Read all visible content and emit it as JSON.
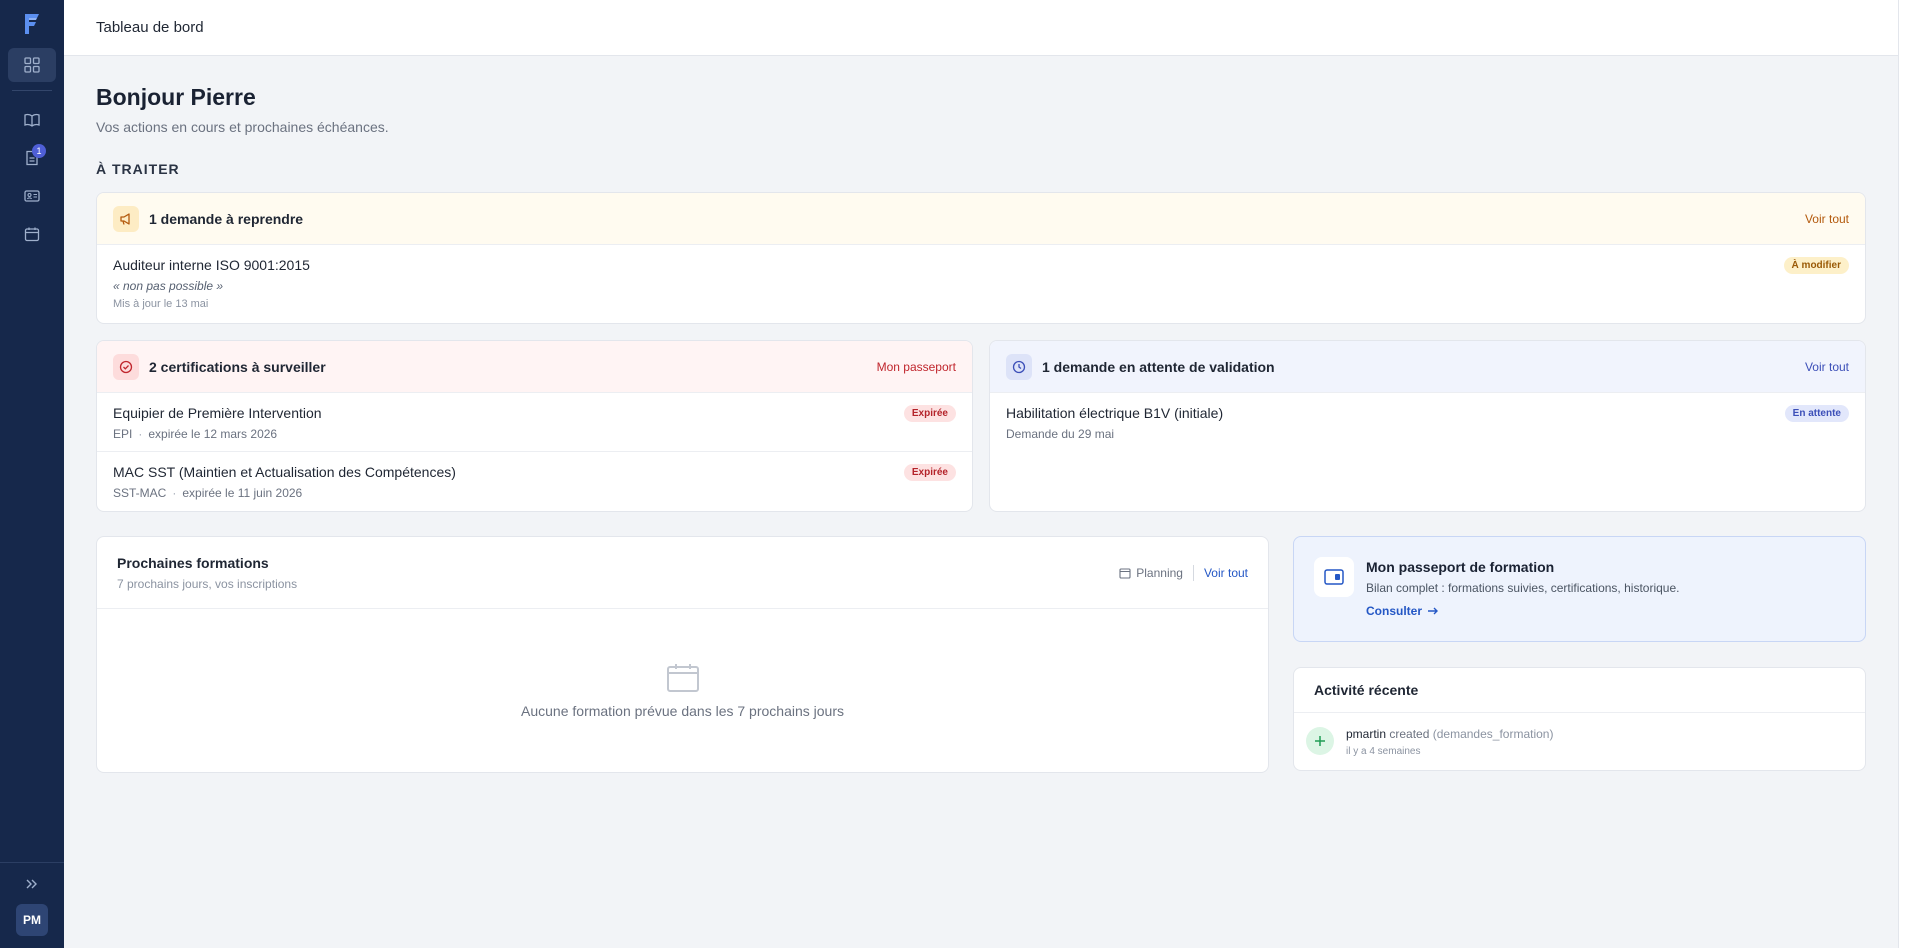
{
  "topbar": {
    "title": "Tableau de bord"
  },
  "sidebar": {
    "badge_count": "1",
    "avatar_initials": "PM"
  },
  "header": {
    "greeting": "Bonjour Pierre",
    "subtitle": "Vos actions en cours et prochaines échéances.",
    "section_title": "À TRAITER"
  },
  "demandes": {
    "title": "1 demande à reprendre",
    "link": "Voir tout",
    "items": [
      {
        "title": "Auditeur interne ISO 9001:2015",
        "quote": "« non pas possible »",
        "meta": "Mis à jour le 13 mai",
        "badge": "À modifier"
      }
    ]
  },
  "certifications": {
    "title": "2 certifications à surveiller",
    "link": "Mon passeport",
    "items": [
      {
        "title": "Equipier de Première Intervention",
        "code": "EPI",
        "detail": "expirée le 12 mars 2026",
        "badge": "Expirée"
      },
      {
        "title": "MAC SST (Maintien et Actualisation des Compétences)",
        "code": "SST-MAC",
        "detail": "expirée le 11 juin 2026",
        "badge": "Expirée"
      }
    ]
  },
  "validation": {
    "title": "1 demande en attente de validation",
    "link": "Voir tout",
    "items": [
      {
        "title": "Habilitation électrique B1V (initiale)",
        "sub": "Demande du 29 mai",
        "badge": "En attente"
      }
    ]
  },
  "formations": {
    "title": "Prochaines formations",
    "subtitle": "7 prochains jours, vos inscriptions",
    "planning_label": "Planning",
    "link": "Voir tout",
    "empty_text": "Aucune formation prévue dans les 7 prochains jours"
  },
  "passport": {
    "title": "Mon passeport de formation",
    "desc": "Bilan complet : formations suivies, certifications, historique.",
    "link": "Consulter"
  },
  "activity": {
    "title": "Activité récente",
    "items": [
      {
        "user": "pmartin",
        "action": "created",
        "target": "(demandes_formation)",
        "time": "il y a 4 semaines"
      }
    ]
  },
  "colors": {
    "sidebar": "#16284b",
    "accent_blue": "#2457c5",
    "warning_text": "#b3590c",
    "danger_text": "#c0262d"
  }
}
